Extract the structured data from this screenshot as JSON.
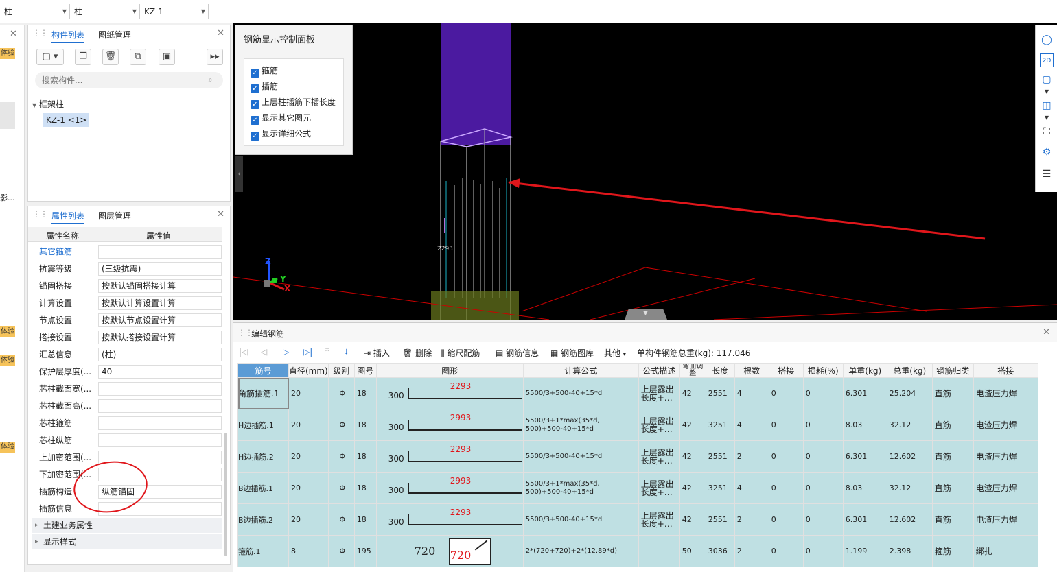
{
  "topbar": {
    "combo1": "柱",
    "combo2": "柱",
    "combo3": "KZ-1"
  },
  "leftstrip": {
    "badge": "体验",
    "side_text": "影..."
  },
  "component_panel": {
    "tab1": "构件列表",
    "tab2": "图纸管理",
    "search_placeholder": "搜索构件...",
    "tree_group": "框架柱",
    "tree_item": "KZ-1 <1>"
  },
  "property_panel": {
    "tab1": "属性列表",
    "tab2": "图层管理",
    "col_name": "属性名称",
    "col_value": "属性值",
    "rows": [
      {
        "name": "其它箍筋",
        "value": "",
        "link": true
      },
      {
        "name": "抗震等级",
        "value": "(三级抗震)"
      },
      {
        "name": "锚固搭接",
        "value": "按默认锚固搭接计算"
      },
      {
        "name": "计算设置",
        "value": "按默认计算设置计算"
      },
      {
        "name": "节点设置",
        "value": "按默认节点设置计算"
      },
      {
        "name": "搭接设置",
        "value": "按默认搭接设置计算"
      },
      {
        "name": "汇总信息",
        "value": "(柱)"
      },
      {
        "name": "保护层厚度(...",
        "value": "40"
      },
      {
        "name": "芯柱截面宽(...",
        "value": ""
      },
      {
        "name": "芯柱截面高(...",
        "value": ""
      },
      {
        "name": "芯柱箍筋",
        "value": ""
      },
      {
        "name": "芯柱纵筋",
        "value": ""
      },
      {
        "name": "上加密范围(...",
        "value": ""
      },
      {
        "name": "下加密范围(...",
        "value": ""
      },
      {
        "name": "插筋构造",
        "value": "纵筋锚固"
      },
      {
        "name": "插筋信息",
        "value": ""
      }
    ],
    "groups": [
      "土建业务属性",
      "显示样式"
    ]
  },
  "control_panel": {
    "title": "钢筋显示控制面板",
    "options": [
      "箍筋",
      "插筋",
      "上层柱插筋下插长度",
      "显示其它图元",
      "显示详细公式"
    ]
  },
  "view3d": {
    "dim_label": "2293",
    "axis_x": "X",
    "axis_y": "Y",
    "axis_z": "Z"
  },
  "editor": {
    "title": "编辑钢筋",
    "tools": {
      "insert": "插入",
      "delete": "删除",
      "scale": "缩尺配筋",
      "info": "钢筋信息",
      "library": "钢筋图库",
      "other": "其他",
      "total": "单构件钢筋总重(kg): 117.046"
    },
    "columns": [
      "筋号",
      "直径(mm)",
      "级别",
      "图号",
      "图形",
      "计算公式",
      "公式描述",
      "弯曲调整",
      "长度",
      "根数",
      "搭接",
      "损耗(%)",
      "单重(kg)",
      "总重(kg)",
      "钢筋归类",
      "搭接"
    ],
    "rows": [
      {
        "no": "1",
        "name": "角筋插筋.1",
        "dia": "20",
        "grade": "Φ",
        "fig": "18",
        "left": "300",
        "mid": "2293",
        "formula": "5500/3+500-40+15*d",
        "desc": "上层露出长度+…",
        "bend": "42",
        "len": "2551",
        "count": "4",
        "lap": "0",
        "loss": "0",
        "unit": "6.301",
        "total": "25.204",
        "type": "直筋",
        "join": "电渣压力焊"
      },
      {
        "no": "2",
        "name": "H边插筋.1",
        "dia": "20",
        "grade": "Φ",
        "fig": "18",
        "left": "300",
        "mid": "2993",
        "formula": "5500/3+1*max(35*d, 500)+500-40+15*d",
        "desc": "上层露出长度+…",
        "bend": "42",
        "len": "3251",
        "count": "4",
        "lap": "0",
        "loss": "0",
        "unit": "8.03",
        "total": "32.12",
        "type": "直筋",
        "join": "电渣压力焊"
      },
      {
        "no": "3",
        "name": "H边插筋.2",
        "dia": "20",
        "grade": "Φ",
        "fig": "18",
        "left": "300",
        "mid": "2293",
        "formula": "5500/3+500-40+15*d",
        "desc": "上层露出长度+…",
        "bend": "42",
        "len": "2551",
        "count": "2",
        "lap": "0",
        "loss": "0",
        "unit": "6.301",
        "total": "12.602",
        "type": "直筋",
        "join": "电渣压力焊"
      },
      {
        "no": "4",
        "name": "B边插筋.1",
        "dia": "20",
        "grade": "Φ",
        "fig": "18",
        "left": "300",
        "mid": "2993",
        "formula": "5500/3+1*max(35*d, 500)+500-40+15*d",
        "desc": "上层露出长度+…",
        "bend": "42",
        "len": "3251",
        "count": "4",
        "lap": "0",
        "loss": "0",
        "unit": "8.03",
        "total": "32.12",
        "type": "直筋",
        "join": "电渣压力焊"
      },
      {
        "no": "5",
        "name": "B边插筋.2",
        "dia": "20",
        "grade": "Φ",
        "fig": "18",
        "left": "300",
        "mid": "2293",
        "formula": "5500/3+500-40+15*d",
        "desc": "上层露出长度+…",
        "bend": "42",
        "len": "2551",
        "count": "2",
        "lap": "0",
        "loss": "0",
        "unit": "6.301",
        "total": "12.602",
        "type": "直筋",
        "join": "电渣压力焊"
      },
      {
        "no": "6",
        "name": "箍筋.1",
        "dia": "8",
        "grade": "Φ",
        "fig": "195",
        "left": "720",
        "mid": "720",
        "formula": "2*(720+720)+2*(12.89*d)",
        "desc": "",
        "bend": "50",
        "len": "3036",
        "count": "2",
        "lap": "0",
        "loss": "0",
        "unit": "1.199",
        "total": "2.398",
        "type": "箍筋",
        "join": "绑扎"
      }
    ]
  }
}
